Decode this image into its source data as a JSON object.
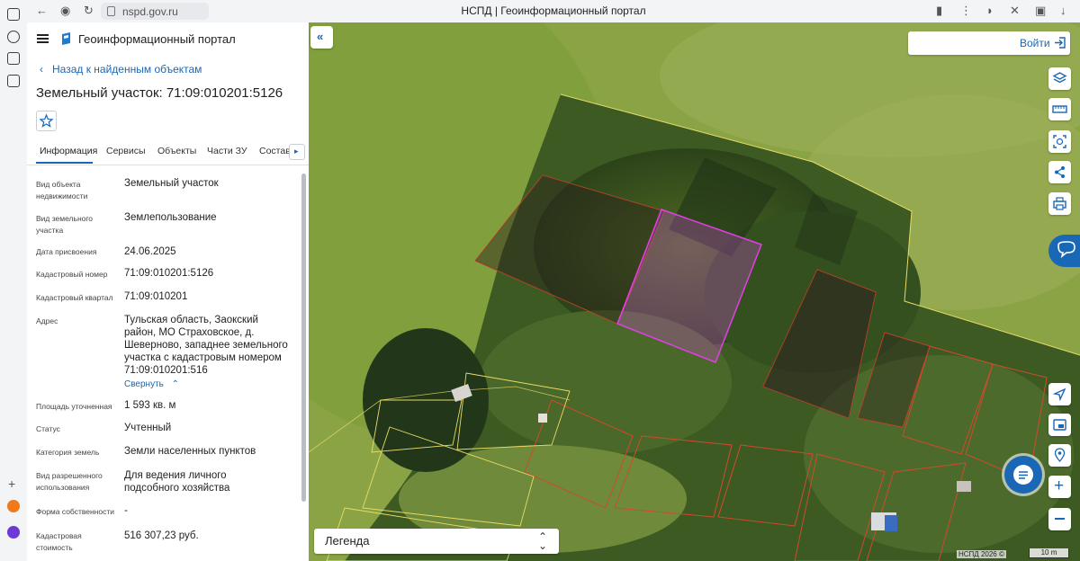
{
  "browser": {
    "url": "nspd.gov.ru",
    "tab_title": "НСПД | Геоинформационный портал"
  },
  "panel": {
    "portal_name": "Геоинформационный портал",
    "back_link": "Назад к найденным объектам",
    "object_title": "Земельный участок: 71:09:010201:5126",
    "tabs": [
      {
        "label": "Информация",
        "active": true
      },
      {
        "label": "Сервисы",
        "active": false
      },
      {
        "label": "Объекты",
        "active": false
      },
      {
        "label": "Части ЗУ",
        "active": false
      },
      {
        "label": "Состав",
        "active": false
      }
    ],
    "fields": [
      {
        "label": "Вид объекта недвижимости",
        "value": "Земельный участок"
      },
      {
        "label": "Вид земельного участка",
        "value": "Землепользование"
      },
      {
        "label": "Дата присвоения",
        "value": "24.06.2025"
      },
      {
        "label": "Кадастровый номер",
        "value": "71:09:010201:5126"
      },
      {
        "label": "Кадастровый квартал",
        "value": "71:09:010201"
      },
      {
        "label": "Адрес",
        "value": "Тульская область, Заокский район, МО Страховское, д. Шеверново, западнее земельного участка с кадастровым номером 71:09:010201:516"
      },
      {
        "label": "Площадь уточненная",
        "value": "1 593 кв. м"
      },
      {
        "label": "Статус",
        "value": "Учтенный"
      },
      {
        "label": "Категория земель",
        "value": "Земли населенных пунктов"
      },
      {
        "label": "Вид разрешенного использования",
        "value": "Для ведения личного подсобного хозяйства"
      },
      {
        "label": "Форма собственности",
        "value": "-"
      },
      {
        "label": "Кадастровая стоимость",
        "value": "516 307,23 руб."
      }
    ],
    "collapse_label": "Свернуть"
  },
  "map": {
    "login_label": "Войти",
    "legend_label": "Легенда",
    "copyright": "НСПД 2026 ©",
    "scale_label": "10 m",
    "colors": {
      "accent": "#1967b5",
      "selected_parcel": "#d63bd6",
      "parcel_border": "#d24a2a"
    }
  }
}
